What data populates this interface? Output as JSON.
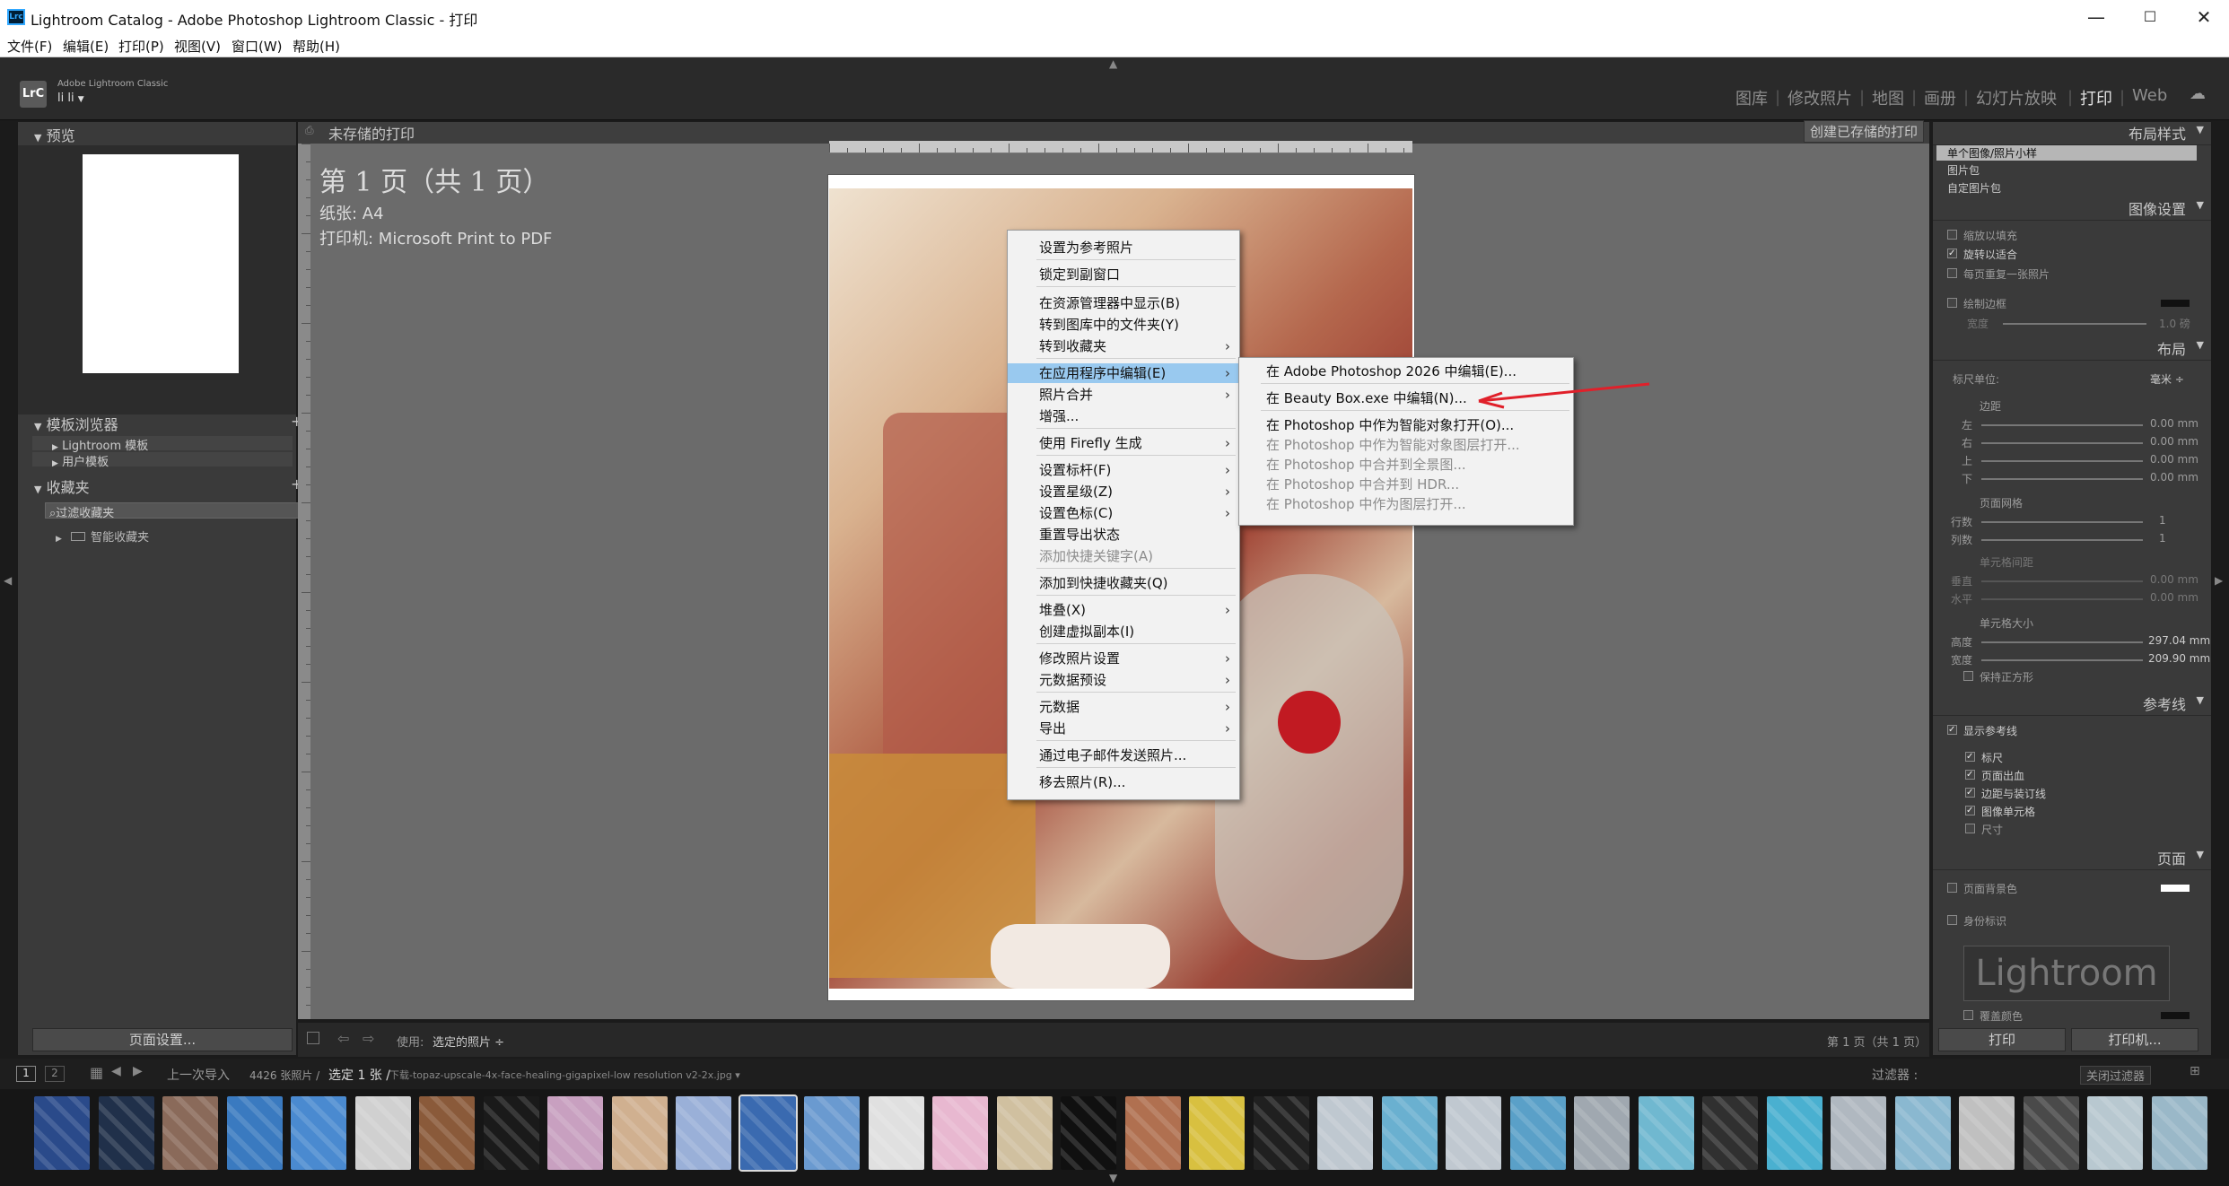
{
  "window": {
    "title": "Lightroom Catalog - Adobe Photoshop Lightroom Classic - 打印",
    "icon": "Lrc",
    "minimize": "—",
    "maximize": "☐",
    "close": "✕"
  },
  "menubar": [
    "文件(F)",
    "编辑(E)",
    "打印(P)",
    "视图(V)",
    "窗口(W)",
    "帮助(H)"
  ],
  "identity": {
    "logo": "LrC",
    "app": "Adobe Lightroom Classic",
    "user": "li li",
    "user_arrow": "▼"
  },
  "modules": [
    "图库",
    "修改照片",
    "地图",
    "画册",
    "幻灯片放映",
    "打印",
    "Web"
  ],
  "active_module": "打印",
  "left": {
    "preview": "预览",
    "template_browser": "模板浏览器",
    "templates": [
      "Lightroom 模板",
      "用户模板"
    ],
    "collections": "收藏夹",
    "collection_items": [
      "过滤收藏夹",
      "智能收藏夹"
    ],
    "page_setup": "页面设置..."
  },
  "center": {
    "header": "未存储的打印",
    "create_saved": "创建已存储的打印",
    "page_title": "第 1 页（共 1 页）",
    "paper": "纸张: A4",
    "printer": "打印机: Microsoft Print to PDF"
  },
  "context_menu": [
    {
      "label": "设置为参考照片",
      "sub": false,
      "dis": false
    },
    {
      "label": "锁定到副窗口",
      "sub": false,
      "dis": false
    },
    {
      "label": "在资源管理器中显示(B)",
      "sub": false,
      "dis": false
    },
    {
      "label": "转到图库中的文件夹(Y)",
      "sub": false,
      "dis": false
    },
    {
      "label": "转到收藏夹",
      "sub": true,
      "dis": false
    },
    {
      "label": "在应用程序中编辑(E)",
      "sub": true,
      "dis": false
    },
    {
      "label": "照片合并",
      "sub": true,
      "dis": false
    },
    {
      "label": "增强...",
      "sub": false,
      "dis": false
    },
    {
      "label": "使用 Firefly 生成",
      "sub": true,
      "dis": false
    },
    {
      "label": "设置标杆(F)",
      "sub": true,
      "dis": false
    },
    {
      "label": "设置星级(Z)",
      "sub": true,
      "dis": false
    },
    {
      "label": "设置色标(C)",
      "sub": true,
      "dis": false
    },
    {
      "label": "重置导出状态",
      "sub": false,
      "dis": false
    },
    {
      "label": "添加快捷关键字(A)",
      "sub": false,
      "dis": true
    },
    {
      "label": "添加到快捷收藏夹(Q)",
      "sub": false,
      "dis": false
    },
    {
      "label": "堆叠(X)",
      "sub": true,
      "dis": false
    },
    {
      "label": "创建虚拟副本(I)",
      "sub": false,
      "dis": false
    },
    {
      "label": "修改照片设置",
      "sub": true,
      "dis": false
    },
    {
      "label": "元数据预设",
      "sub": true,
      "dis": false
    },
    {
      "label": "元数据",
      "sub": true,
      "dis": false
    },
    {
      "label": "导出",
      "sub": true,
      "dis": false
    },
    {
      "label": "通过电子邮件发送照片...",
      "sub": false,
      "dis": false
    },
    {
      "label": "移去照片(R)...",
      "sub": false,
      "dis": false
    }
  ],
  "submenu": [
    {
      "label": "在 Adobe Photoshop 2026 中编辑(E)...",
      "dis": false
    },
    {
      "label": "在 Beauty Box.exe 中编辑(N)...",
      "dis": false
    },
    {
      "label": "在 Photoshop 中作为智能对象打开(O)...",
      "dis": false
    },
    {
      "label": "在 Photoshop 中作为智能对象图层打开...",
      "dis": true
    },
    {
      "label": "在 Photoshop 中合并到全景图...",
      "dis": true
    },
    {
      "label": "在 Photoshop 中合并到 HDR...",
      "dis": true
    },
    {
      "label": "在 Photoshop 中作为图层打开...",
      "dis": true
    }
  ],
  "right": {
    "layout_style": "布局样式",
    "layout_options": [
      "单个图像/照片小样",
      "图片包",
      "自定图片包"
    ],
    "image_settings": "图像设置",
    "image_opts": [
      "缩放以填充",
      "旋转以适合",
      "每页重复一张照片"
    ],
    "image_checked": [
      false,
      true,
      false
    ],
    "stroke_border": "绘制边框",
    "width_label": "宽度",
    "width_val": "1.0 磅",
    "layout": "布局",
    "ruler_units": "标尺单位:",
    "units": "毫米 ÷",
    "margins": "边距",
    "margin_labels": [
      "左",
      "右",
      "上",
      "下"
    ],
    "margin_vals": [
      "0.00 mm",
      "0.00 mm",
      "0.00 mm",
      "0.00 mm"
    ],
    "page_grid": "页面网格",
    "grid_labels": [
      "行数",
      "列数"
    ],
    "grid_vals": [
      "1",
      "1"
    ],
    "cell_spacing": "单元格间距",
    "spacing_labels": [
      "垂直",
      "水平"
    ],
    "spacing_vals": [
      "0.00 mm",
      "0.00 mm"
    ],
    "cell_size": "单元格大小",
    "size_labels": [
      "高度",
      "宽度"
    ],
    "size_vals": [
      "297.04 mm",
      "209.90 mm"
    ],
    "keep_square": "保持正方形",
    "guides": "参考线",
    "show_guides": "显示参考线",
    "guide_opts": [
      "标尺",
      "页面出血",
      "边距与装订线",
      "图像单元格",
      "尺寸"
    ],
    "guide_checked": [
      true,
      true,
      true,
      true,
      false
    ],
    "page": "页面",
    "page_bg": "页面背景色",
    "identity_plate": "身份标识",
    "plate_text": "Lightroom",
    "overlay_color": "覆盖颜色",
    "print": "打印",
    "printer_btn": "打印机..."
  },
  "toolbar": {
    "use": "使用:",
    "use_val": "选定的照片 ÷",
    "page_count": "第 1 页（共 1 页）"
  },
  "filmstrip": {
    "tab1": "1",
    "tab2": "2",
    "source": "上一次导入",
    "count": "4426 张照片 /",
    "selected": "选定 1 张 /",
    "filename": "下载-topaz-upscale-4x-face-healing-gigapixel-low resolution v2-2x.jpg ▾",
    "filter_label": "过滤器 :",
    "filter_val": "关闭过滤器"
  }
}
